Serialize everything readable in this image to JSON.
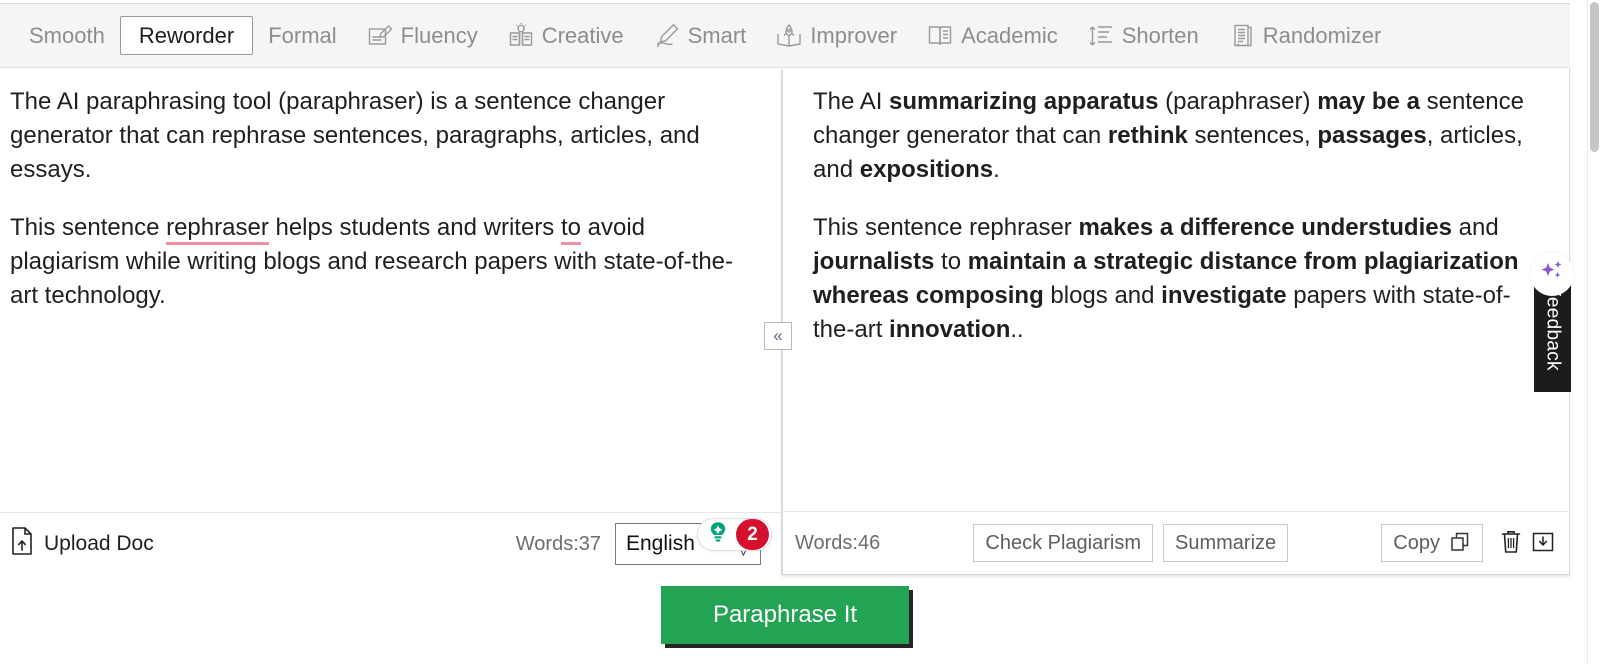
{
  "tabs": [
    {
      "label": "Smooth",
      "icon": "none",
      "active": false
    },
    {
      "label": "Reworder",
      "icon": "none",
      "active": true
    },
    {
      "label": "Formal",
      "icon": "none",
      "active": false
    },
    {
      "label": "Fluency",
      "icon": "document-pen-icon",
      "active": false
    },
    {
      "label": "Creative",
      "icon": "book-bulb-icon",
      "active": false
    },
    {
      "label": "Smart",
      "icon": "pen-hand-icon",
      "active": false
    },
    {
      "label": "Improver",
      "icon": "book-rocket-icon",
      "active": false
    },
    {
      "label": "Academic",
      "icon": "open-book-icon",
      "active": false
    },
    {
      "label": "Shorten",
      "icon": "shorten-lines-icon",
      "active": false
    },
    {
      "label": "Randomizer",
      "icon": "pages-stack-icon",
      "active": false
    }
  ],
  "left_pane": {
    "paragraph_1_parts": [
      {
        "text": "The AI paraphrasing tool (paraphraser) is a sentence changer generator that can rephrase sentences, paragraphs, articles, and essays.",
        "error": false
      }
    ],
    "paragraph_2_parts": [
      {
        "text": "This sentence ",
        "error": false
      },
      {
        "text": "rephraser",
        "error": true
      },
      {
        "text": " helps students and writers ",
        "error": false
      },
      {
        "text": "to",
        "error": true
      },
      {
        "text": " avoid plagiarism while writing blogs and research papers with state-of-the-art technology.",
        "error": false
      }
    ],
    "suggestion_count": "2",
    "upload_label": "Upload Doc",
    "word_count": "Words:37",
    "language": "English"
  },
  "right_pane": {
    "paragraph_1_parts": [
      {
        "text": "The AI ",
        "bold": false
      },
      {
        "text": "summarizing apparatus",
        "bold": true
      },
      {
        "text": " (paraphraser) ",
        "bold": false
      },
      {
        "text": "may be a",
        "bold": true
      },
      {
        "text": " sentence changer generator that can ",
        "bold": false
      },
      {
        "text": "rethink",
        "bold": true
      },
      {
        "text": " sentences, ",
        "bold": false
      },
      {
        "text": "passages",
        "bold": true
      },
      {
        "text": ", articles, and ",
        "bold": false
      },
      {
        "text": "expositions",
        "bold": true
      },
      {
        "text": ".",
        "bold": false
      }
    ],
    "paragraph_2_parts": [
      {
        "text": "This sentence rephraser ",
        "bold": false
      },
      {
        "text": "makes a difference understudies",
        "bold": true
      },
      {
        "text": " and ",
        "bold": false
      },
      {
        "text": "journalists",
        "bold": true
      },
      {
        "text": " to ",
        "bold": false
      },
      {
        "text": "maintain a strategic distance from plagiarization whereas composing",
        "bold": true
      },
      {
        "text": " blogs and ",
        "bold": false
      },
      {
        "text": "investigate",
        "bold": true
      },
      {
        "text": " papers with state-of-the-art ",
        "bold": false
      },
      {
        "text": "innovation",
        "bold": true
      },
      {
        "text": "..",
        "bold": false
      }
    ],
    "word_count": "Words:46",
    "check_plagiarism_label": "Check Plagiarism",
    "summarize_label": "Summarize",
    "copy_label": "Copy"
  },
  "collapse_icon": "«",
  "feedback": {
    "label": "Feedback",
    "icon": "sparkles-icon",
    "accent": "#8b5bd1"
  },
  "cta": {
    "label": "Paraphrase It",
    "color": "#23a455"
  },
  "colors": {
    "error_underline": "#f58ea0",
    "badge_red": "#d50f2e",
    "bulb_green": "#00a57c",
    "tabbar_bg": "#f5f5f5"
  }
}
